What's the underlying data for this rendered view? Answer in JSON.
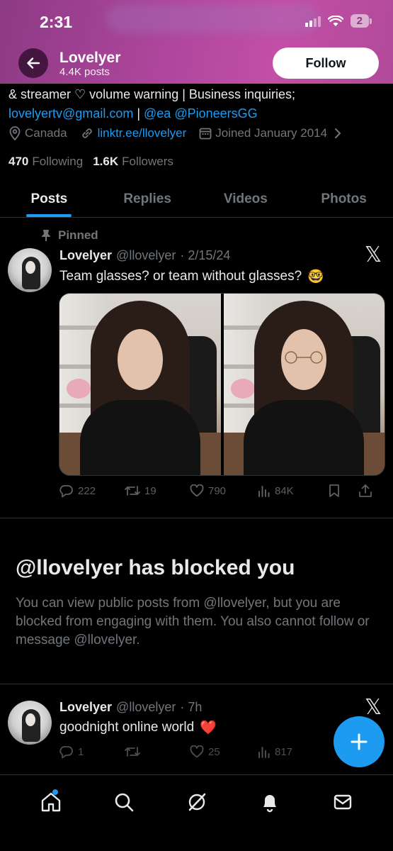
{
  "status_bar": {
    "time": "2:31",
    "battery": "2"
  },
  "header": {
    "name": "Lovelyer",
    "posts": "4.4K posts",
    "follow_label": "Follow"
  },
  "bio": {
    "line1": "& streamer ♡ volume warning | Business inquiries;",
    "email": "lovelyertv@gmail.com",
    "sep": " | ",
    "mention1": "@ea",
    "mention2": "@PioneersGG"
  },
  "meta": {
    "location": "Canada",
    "link": "linktr.ee/llovelyer",
    "joined": "Joined January 2014"
  },
  "counts": {
    "following_value": "470",
    "following_label": "Following",
    "followers_value": "1.6K",
    "followers_label": "Followers"
  },
  "tabs": [
    {
      "label": "Posts"
    },
    {
      "label": "Replies"
    },
    {
      "label": "Videos"
    },
    {
      "label": "Photos"
    }
  ],
  "pinned_post": {
    "pinned_label": "Pinned",
    "name": "Lovelyer",
    "handle": "@llovelyer",
    "date": "· 2/15/24",
    "text": "Team glasses? or team without glasses?",
    "emoji": "🤓",
    "replies": "222",
    "reposts": "19",
    "likes": "790",
    "views": "84K"
  },
  "blocked": {
    "title": "@llovelyer has blocked you",
    "text": "You can view public posts from @llovelyer, but you are blocked from engaging with them. You also cannot follow or message @llovelyer."
  },
  "second_post": {
    "name": "Lovelyer",
    "handle": "@llovelyer",
    "date": "· 7h",
    "text": "goodnight online world",
    "emoji": "❤️",
    "replies": "1",
    "likes": "25",
    "views": "817"
  },
  "colors": {
    "accent": "#1d9bf0",
    "muted": "#71767b",
    "text": "#e7e9ea",
    "banner": "#b0479e"
  }
}
